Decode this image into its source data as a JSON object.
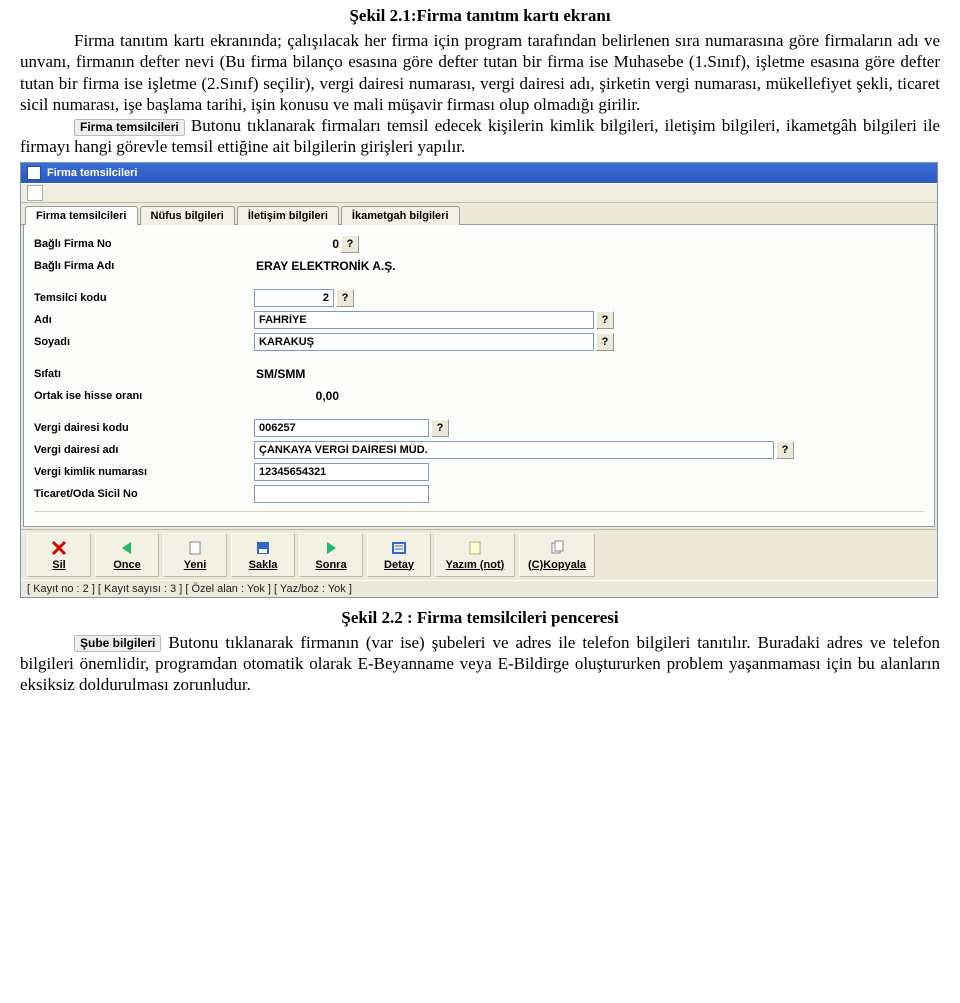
{
  "heading1": "Şekil 2.1:Firma tanıtım kartı ekranı",
  "para1": "Firma tanıtım kartı ekranında; çalışılacak her firma için program tarafından belirlenen sıra numarasına göre firmaların adı ve unvanı, firmanın defter nevi (Bu firma bilanço esasına göre defter tutan bir firma ise Muhasebe (1.Sınıf), işletme esasına göre defter tutan bir firma ise işletme (2.Sınıf) seçilir), vergi dairesi numarası, vergi dairesi adı, şirketin vergi numarası, mükellefiyet şekli, ticaret sicil numarası, işe başlama tarihi, işin konusu ve mali müşavir firması olup olmadığı girilir.",
  "btn1": "Firma temsilcileri",
  "para2": " Butonu tıklanarak firmaları temsil edecek kişilerin kimlik bilgileri, iletişim bilgileri, ikametgâh bilgileri ile firmayı hangi görevle temsil ettiğine ait bilgilerin girişleri yapılır.",
  "window": {
    "title": "Firma temsilcileri",
    "tabs": [
      "Firma temsilcileri",
      "Nüfus bilgileri",
      "İletişim bilgileri",
      "İkametgah bilgileri"
    ],
    "labels": {
      "bagliNo": "Bağlı Firma No",
      "bagliAdi": "Bağlı Firma Adı",
      "temsilciKodu": "Temsilci kodu",
      "adi": "Adı",
      "soyadi": "Soyadı",
      "sifati": "Sıfatı",
      "ortakHisse": "Ortak ise hisse oranı",
      "vergiDairesiKodu": "Vergi dairesi kodu",
      "vergiDairesiAdi": "Vergi dairesi adı",
      "vergiKimlik": "Vergi kimlik numarası",
      "ticaretSicil": "Ticaret/Oda Sicil No"
    },
    "values": {
      "bagliNo": "0",
      "bagliAdi": "ERAY ELEKTRONİK A.Ş.",
      "temsilciKodu": "2",
      "adi": "FAHRİYE",
      "soyadi": "KARAKUŞ",
      "sifati": "SM/SMM",
      "ortakHisse": "0,00",
      "vergiDairesiKodu": "006257",
      "vergiDairesiAdi": "ÇANKAYA VERGİ DAİRESİ MÜD.",
      "vergiKimlik": "12345654321",
      "ticaretSicil": ""
    },
    "q": "?",
    "toolbar": [
      "Sil",
      "Once",
      "Yeni",
      "Sakla",
      "Sonra",
      "Detay",
      "Yazım (not)",
      "(C)Kopyala"
    ],
    "status": "[ Kayıt no : 2 ] [ Kayıt sayısı : 3 ] [ Özel alan : Yok ] [ Yaz/boz : Yok ]"
  },
  "caption2": "Şekil 2.2 :   Firma temsilcileri penceresi",
  "btn2": "Şube bilgileri",
  "para3": " Butonu tıklanarak firmanın (var ise) şubeleri ve adres ile telefon bilgileri tanıtılır. Buradaki adres ve telefon bilgileri önemlidir, programdan otomatik olarak E-Beyanname veya E-Bildirge oluştururken problem yaşanmaması için bu alanların eksiksiz doldurulması zorunludur."
}
